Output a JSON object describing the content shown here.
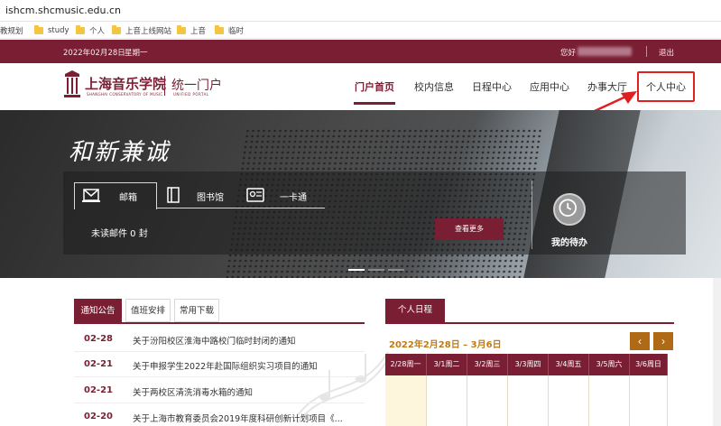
{
  "browser": {
    "url": "ishcm.shcmusic.edu.cn",
    "bookmarks": [
      "教规划",
      "study",
      "个人",
      "上音上线网站",
      "上音",
      "临时"
    ]
  },
  "topbar": {
    "date": "2022年02月28日",
    "weekday": "星期一",
    "greeting": "您好",
    "logout": "退出"
  },
  "header": {
    "logo_name": "上海音乐学院",
    "logo_en": "SHANGHAI CONSERVATORY OF MUSIC",
    "portal_name": "统一门户",
    "portal_en": "UNIFIED PORTAL",
    "nav": [
      "门户首页",
      "校内信息",
      "日程中心",
      "应用中心",
      "办事大厅",
      "个人中心"
    ],
    "active_nav": "门户首页"
  },
  "banner": {
    "slogan": "和新兼诚",
    "tabs": [
      "邮箱",
      "图书馆",
      "一卡通"
    ],
    "mail_status": "未读邮件 0 封",
    "more_button": "查看更多",
    "todo_label": "我的待办"
  },
  "notices": {
    "tabs": [
      "通知公告",
      "值班安排",
      "常用下载"
    ],
    "items": [
      {
        "date": "02-28",
        "title": "关于汾阳校区淮海中路校门临时封闭的通知"
      },
      {
        "date": "02-21",
        "title": "关于申报学生2022年赴国际组织实习项目的通知"
      },
      {
        "date": "02-21",
        "title": "关于两校区清洗消毒水箱的通知"
      },
      {
        "date": "02-20",
        "title": "关于上海市教育委员会2019年度科研创新计划项目《..."
      }
    ]
  },
  "schedule": {
    "tab": "个人日程",
    "range": "2022年2月28日 – 3月6日",
    "prev": "‹",
    "next": "›",
    "days": [
      "2/28周一",
      "3/1周二",
      "3/2周三",
      "3/3周四",
      "3/4周五",
      "3/5周六",
      "3/6周日"
    ]
  },
  "colors": {
    "brand": "#7a1f33",
    "accent": "#b06a16",
    "highlight_box": "#e02020"
  }
}
